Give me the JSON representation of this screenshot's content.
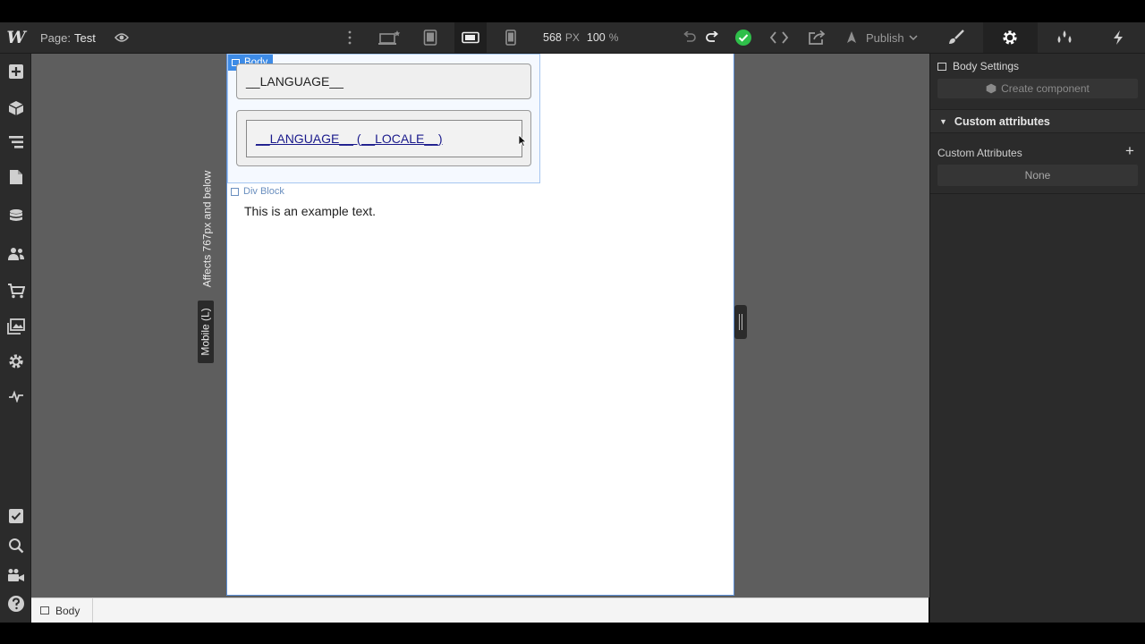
{
  "topbar": {
    "logo": "W",
    "page_key": "Page:",
    "page_value": "Test",
    "width_value": "568",
    "width_unit": "PX",
    "zoom_value": "100",
    "zoom_unit": "%",
    "publish_label": "Publish",
    "status_color": "#2fbf4a"
  },
  "canvas": {
    "breakpoint_note": "Affects 767px and below",
    "breakpoint_name": "Mobile (L)",
    "selected_tag": "Body",
    "language_text": "__LANGUAGE__",
    "locale_link_text": "__LANGUAGE__ (__LOCALE__)",
    "div_block_tag": "Div Block",
    "example_text": "This is an example text."
  },
  "breadcrumb": {
    "items": [
      {
        "label": "Body"
      }
    ]
  },
  "right_panel": {
    "title": "Body Settings",
    "create_component_label": "Create component",
    "section_title": "Custom attributes",
    "attributes_label": "Custom Attributes",
    "attributes_empty": "None"
  },
  "colors": {
    "accent": "#3d8be6",
    "panel_bg": "#2b2b2b",
    "canvas_bg": "#5e5e5e"
  }
}
